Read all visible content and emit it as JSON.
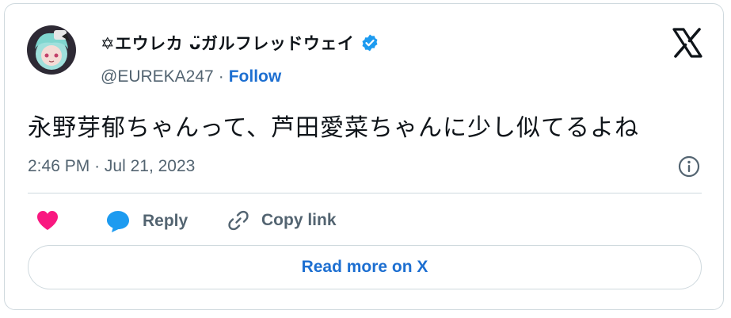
{
  "user": {
    "display_name": "✡エウレカ ᴗ̈ガルフレッドウェイ",
    "handle": "@EUREKA247",
    "separator": "·",
    "follow_label": "Follow"
  },
  "tweet": {
    "text": "永野芽郁ちゃんって、芦田愛菜ちゃんに少し似てるよね",
    "time": "2:46 PM",
    "date_separator": "·",
    "date": "Jul 21, 2023"
  },
  "actions": {
    "reply_label": "Reply",
    "copy_link_label": "Copy link"
  },
  "read_more_label": "Read more on X",
  "colors": {
    "accent": "#1d6fd1",
    "like": "#f91880",
    "reply": "#1d9bf0",
    "muted": "#536471",
    "border": "#cfd9de"
  },
  "icons": [
    "verified-badge-icon",
    "x-logo-icon",
    "info-icon",
    "heart-icon",
    "reply-bubble-icon",
    "link-icon"
  ]
}
